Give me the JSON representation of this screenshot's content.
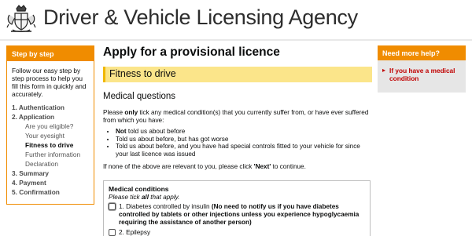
{
  "header": {
    "agency_name": "Driver & Vehicle Licensing Agency"
  },
  "sidebar": {
    "title": "Step by step",
    "intro": "Follow our easy step by step process to help you fill this form in quickly and accurately.",
    "steps": [
      {
        "label": "1. Authentication"
      },
      {
        "label": "2. Application",
        "sub": [
          "Are you eligible?",
          "Your eyesight",
          "Fitness to drive",
          "Further information",
          "Declaration"
        ]
      },
      {
        "label": "3. Summary"
      },
      {
        "label": "4. Payment"
      },
      {
        "label": "5. Confirmation"
      }
    ],
    "current_substep": "Fitness to drive"
  },
  "main": {
    "title": "Apply for a provisional licence",
    "section": "Fitness to drive",
    "subheading": "Medical questions",
    "intro_before": "Please ",
    "intro_bold": "only",
    "intro_after": " tick any medical condition(s) that you currently suffer from, or have ever suffered from which you have:",
    "bullets": [
      {
        "bold": "Not",
        "text": " told us about before"
      },
      {
        "bold": "",
        "text": "Told us about before, but has got worse"
      },
      {
        "bold": "",
        "text": "Told us about before, and you have had special controls fitted to your vehicle for since your last licence was issued"
      }
    ],
    "none_before": "If none of the above are relevant to you, please click ",
    "none_bold": "'Next'",
    "none_after": " to continue.",
    "conditions": {
      "title": "Medical conditions",
      "instr_before": "Please tick ",
      "instr_bold": "all",
      "instr_after": " that apply.",
      "items": [
        {
          "label": "1. Diabetes controlled by insulin ",
          "note": "(No need to notify us if you have diabetes controlled by tablets or other injections unless you experience hypoglycaemia requiring the assistance of another person)"
        },
        {
          "label": "2. Epilepsy",
          "note": ""
        }
      ]
    }
  },
  "help": {
    "title": "Need more help?",
    "link": "If you have a medical condition"
  },
  "colors": {
    "accent": "#f08c00",
    "section_bar": "#fbe58a",
    "link": "#c00000"
  }
}
